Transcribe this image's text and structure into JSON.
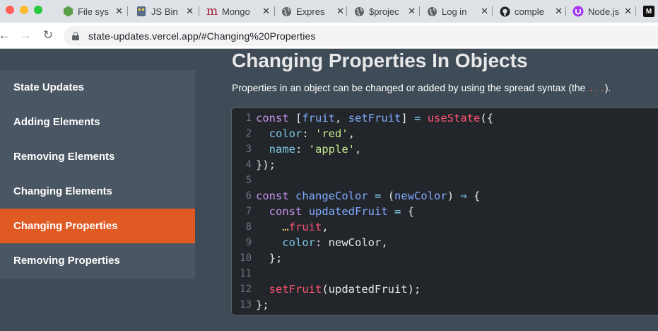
{
  "browser": {
    "tabs": [
      {
        "label": "File sys",
        "icon": "node-icon"
      },
      {
        "label": "JS Bin",
        "icon": "jsbin-icon"
      },
      {
        "label": "Mongo",
        "icon": "mongo-icon"
      },
      {
        "label": "Expres",
        "icon": "globe-icon"
      },
      {
        "label": "$projec",
        "icon": "globe-icon"
      },
      {
        "label": "Log in",
        "icon": "globe-icon"
      },
      {
        "label": "comple",
        "icon": "github-icon"
      },
      {
        "label": "Node.js",
        "icon": "udemy-icon"
      },
      {
        "label": "M",
        "icon": "medium-icon"
      }
    ],
    "close_glyph": "✕",
    "url": "state-updates.vercel.app/#Changing%20Properties"
  },
  "sidebar": {
    "items": [
      {
        "label": "State Updates"
      },
      {
        "label": "Adding Elements"
      },
      {
        "label": "Removing Elements"
      },
      {
        "label": "Changing Elements"
      },
      {
        "label": "Changing Properties"
      },
      {
        "label": "Removing Properties"
      }
    ]
  },
  "main": {
    "title": "Changing Properties In Objects",
    "description_prefix": "Properties in an object can be changed or added by using the spread syntax (the ",
    "description_spread": "...",
    "description_suffix": ")."
  },
  "code": {
    "line_numbers": [
      "1",
      "2",
      "3",
      "4",
      "5",
      "6",
      "7",
      "8",
      "9",
      "10",
      "11",
      "12",
      "13"
    ]
  },
  "colors": {
    "accent": "#e05a24",
    "sidebar_bg": "#4a5663",
    "page_bg": "#3f4b57",
    "code_bg": "#22262b"
  }
}
